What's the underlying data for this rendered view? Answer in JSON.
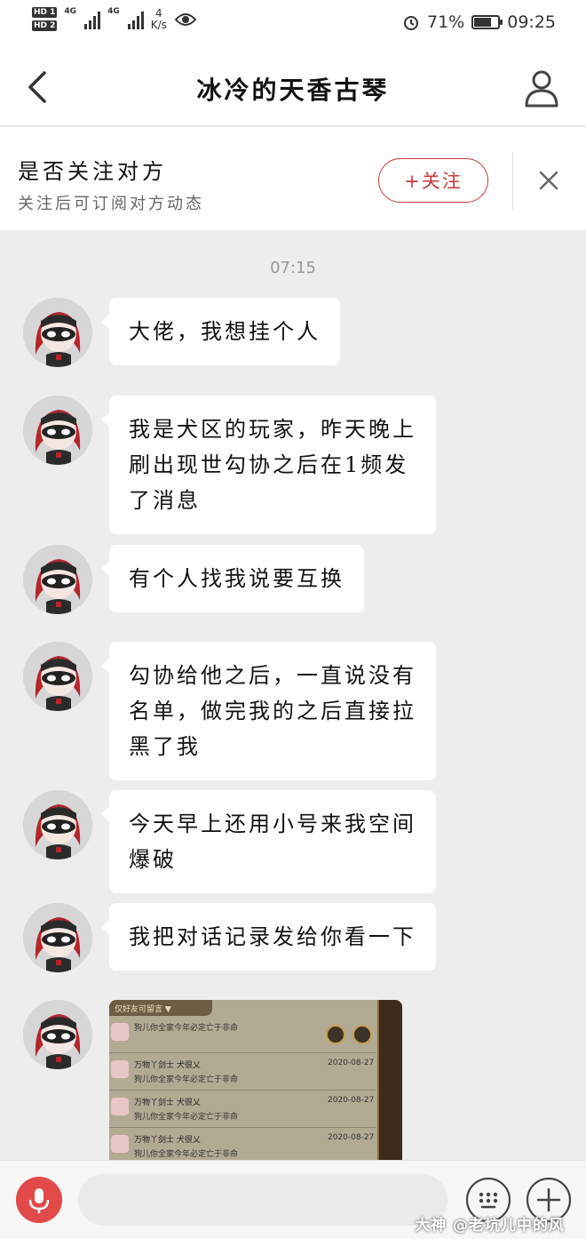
{
  "status_bar": {
    "hd1": "HD 1",
    "hd2": "HD 2",
    "network1": "4G",
    "network2": "4G",
    "speed_value": "4",
    "speed_unit": "K/s",
    "battery_percent": "71%",
    "battery_level": 0.71,
    "time": "09:25",
    "icons": [
      "eye-icon",
      "alarm-icon",
      "battery-icon"
    ]
  },
  "header": {
    "title": "冰冷的天香古琴",
    "back_icon": "chevron-left-icon",
    "profile_icon": "user-icon"
  },
  "follow_prompt": {
    "title": "是否关注对方",
    "subtitle": "关注后可订阅对方动态",
    "follow_button": "+关注",
    "close_icon": "close-icon"
  },
  "chat": {
    "timestamp": "07:15",
    "messages": [
      {
        "text": "大佬，我想挂个人"
      },
      {
        "lines": [
          "我是犬区的玩家，昨天晚上",
          "刷出现世勾协之后在1频发",
          "了消息"
        ]
      },
      {
        "text": "有个人找我说要互换"
      },
      {
        "lines": [
          "勾协给他之后，一直说没有",
          "名单，做完我的之后直接拉",
          "黑了我"
        ]
      },
      {
        "lines": [
          "今天早上还用小号来我空间",
          "爆破"
        ]
      },
      {
        "text": "我把对话记录发给你看一下"
      }
    ],
    "image_message": {
      "header": "仅好友可留言 ▼",
      "rows": [
        {
          "name": "",
          "date": "",
          "text": "狗儿你全家今年必定亡于非命"
        },
        {
          "name": "万物丫剑士 犬很乂",
          "date": "2020-08-27",
          "text": "狗儿你全家今年必定亡于非命"
        },
        {
          "name": "万物丫剑士 犬很乂",
          "date": "2020-08-27",
          "text": "狗儿你全家今年必定亡于非命"
        },
        {
          "name": "万物丫剑士 犬很乂",
          "date": "2020-08-27",
          "text": "狗儿你全家今年必定亡于非命"
        }
      ]
    }
  },
  "input_bar": {
    "mic_icon": "microphone-icon",
    "input_placeholder": "",
    "keyboard_icon": "keyboard-icon",
    "plus_icon": "plus-icon",
    "watermark": "大神 @老坑儿中的风"
  },
  "colors": {
    "accent_red": "#c63a3a",
    "mic_red": "#e24a4a",
    "chat_bg": "#ededed"
  }
}
